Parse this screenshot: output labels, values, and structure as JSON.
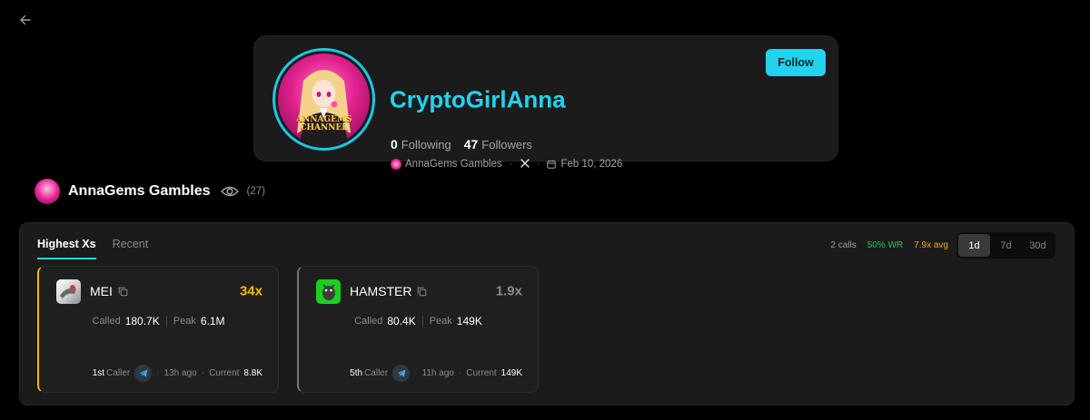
{
  "profile": {
    "name": "CryptoGirlAnna",
    "following_count": "0",
    "following_label": "Following",
    "followers_count": "47",
    "followers_label": "Followers",
    "group_label": "AnnaGems Gambles",
    "x_label": "X",
    "joined_date": "Feb 10, 2026",
    "follow_label": "Follow",
    "avatar_text": "ANNAGEMS CHANNEL"
  },
  "group": {
    "name": "AnnaGems Gambles",
    "watch_count": "(27)"
  },
  "tabs": [
    {
      "label": "Highest Xs",
      "active": true
    },
    {
      "label": "Recent",
      "active": false
    }
  ],
  "summary": {
    "calls": "2 calls",
    "win_rate": "50% WR",
    "avg": "7.9x avg"
  },
  "ranges": [
    {
      "label": "1d",
      "active": true
    },
    {
      "label": "7d",
      "active": false
    },
    {
      "label": "30d",
      "active": false
    }
  ],
  "calls": [
    {
      "token": "MEI",
      "multiplier": "34x",
      "called_label": "Called",
      "called_value": "180.7K",
      "peak_label": "Peak",
      "peak_value": "6.1M",
      "rank": "1st",
      "rank_label": "Caller",
      "time_ago": "13h ago",
      "current_label": "Current",
      "current_value": "8.8K"
    },
    {
      "token": "HAMSTER",
      "multiplier": "1.9x",
      "called_label": "Called",
      "called_value": "80.4K",
      "peak_label": "Peak",
      "peak_value": "149K",
      "rank": "5th",
      "rank_label": "Caller",
      "time_ago": "11h ago",
      "current_label": "Current",
      "current_value": "149K"
    }
  ],
  "colors": {
    "accent": "#22d3ee",
    "gold": "#f5b800",
    "win": "#22c55e",
    "avg": "#f5a623"
  }
}
